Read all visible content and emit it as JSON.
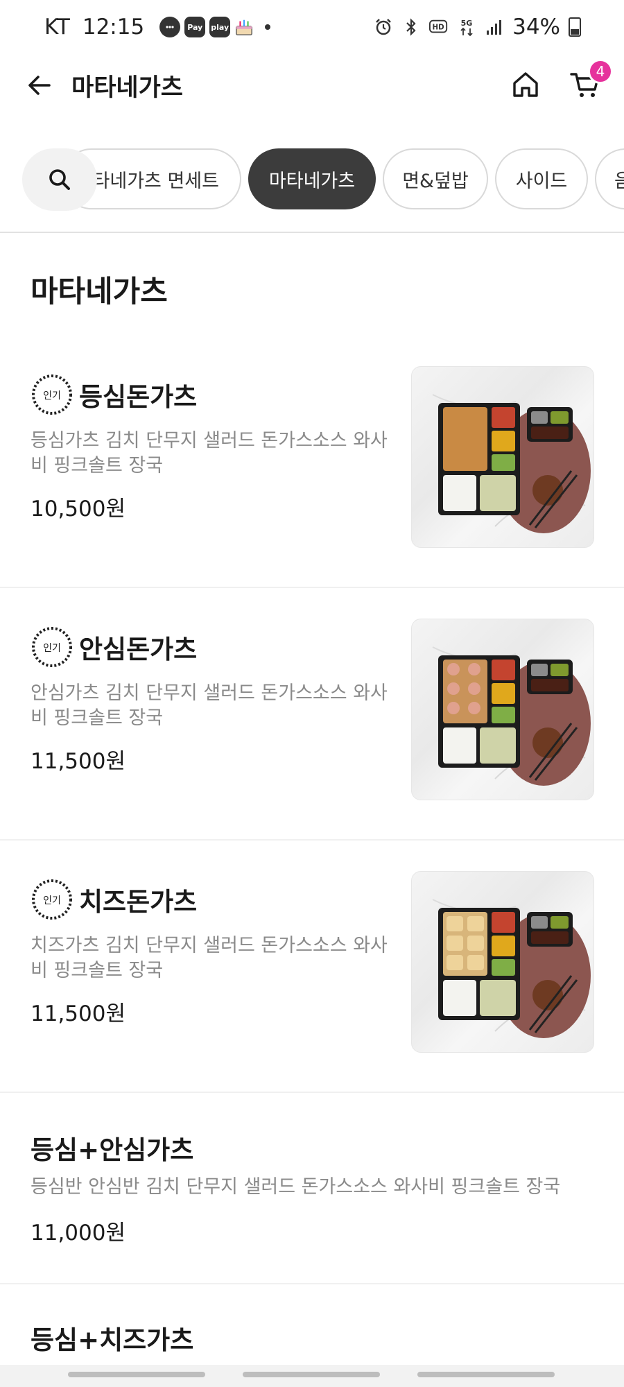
{
  "status_bar": {
    "carrier": "KT",
    "time": "12:15",
    "notif_pay": "Pay",
    "notif_play": "play",
    "battery": "34%"
  },
  "header": {
    "title": "마타네가츠",
    "cart_count": "4"
  },
  "tabs": [
    {
      "label": "마타네가츠 면세트",
      "active": false
    },
    {
      "label": "마타네가츠",
      "active": true
    },
    {
      "label": "면&덮밥",
      "active": false
    },
    {
      "label": "사이드",
      "active": false
    },
    {
      "label": "음",
      "active": false
    }
  ],
  "section": {
    "title": "마타네가츠"
  },
  "popular_badge": "인기",
  "menu_items": [
    {
      "name": "등심돈가츠",
      "desc": "등심가츠 김치 단무지 샐러드 돈가스소스 와사비 핑크솔트 장국",
      "price": "10,500원",
      "popular": true
    },
    {
      "name": "안심돈가츠",
      "desc": "안심가츠 김치 단무지 샐러드 돈가스소스 와사비 핑크솔트 장국",
      "price": "11,500원",
      "popular": true
    },
    {
      "name": "치즈돈가츠",
      "desc": "치즈가츠 김치 단무지 샐러드 돈가스소스 와사비 핑크솔트 장국",
      "price": "11,500원",
      "popular": true
    },
    {
      "name": "등심+안심가츠",
      "desc": "등심반 안심반 김치 단무지 샐러드 돈가스소스 와사비 핑크솔트 장국",
      "price": "11,000원",
      "popular": false
    },
    {
      "name": "등심+치즈가츠"
    }
  ],
  "colors": {
    "accent_badge": "#e6329c",
    "active_tab": "#3c3c3c"
  }
}
